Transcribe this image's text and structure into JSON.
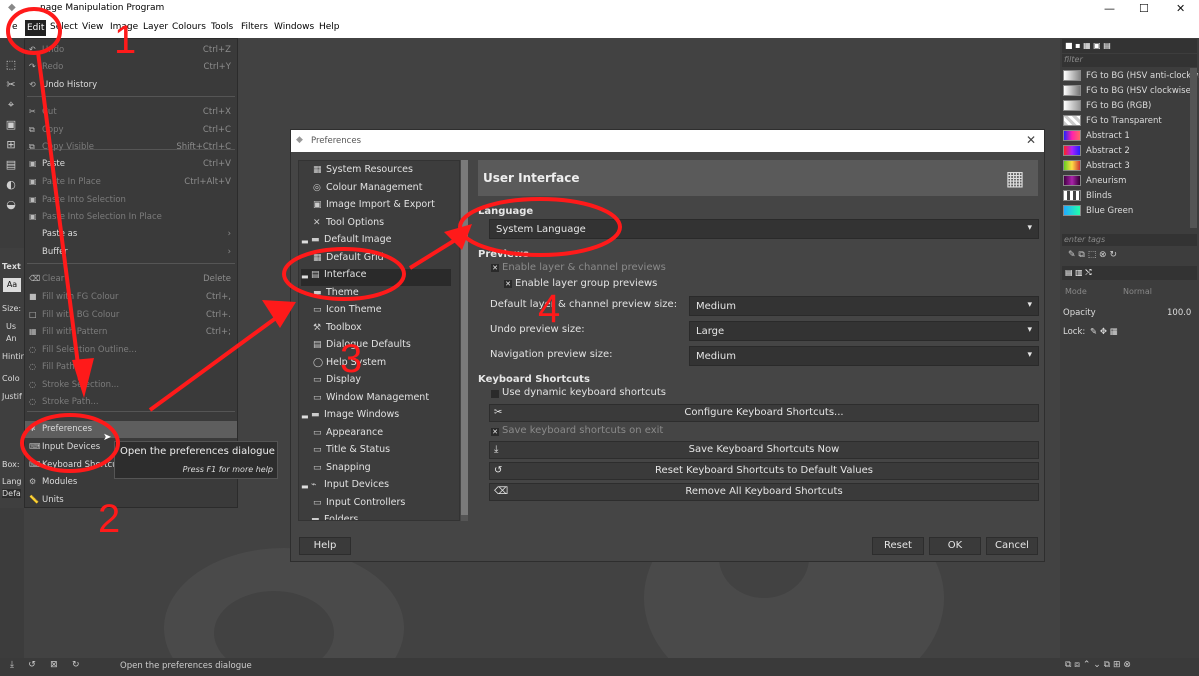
{
  "window": {
    "title": "GNU Image Manipulation Program",
    "title_visible": "nage Manipulation Program"
  },
  "menubar": [
    "e",
    "Edit",
    "Select",
    "View",
    "Image",
    "Layer",
    "Colours",
    "Tools",
    "Filters",
    "Windows",
    "Help"
  ],
  "edit_menu": {
    "items": [
      {
        "label": "Undo",
        "accel": "Ctrl+Z",
        "disabled": true
      },
      {
        "label": "Redo",
        "accel": "Ctrl+Y",
        "disabled": true
      },
      {
        "label": "Undo History",
        "accel": "",
        "disabled": false
      },
      {
        "label": "Cut",
        "accel": "Ctrl+X",
        "disabled": true
      },
      {
        "label": "Copy",
        "accel": "Ctrl+C",
        "disabled": true
      },
      {
        "label": "Copy Visible",
        "accel": "Shift+Ctrl+C",
        "disabled": true
      },
      {
        "label": "Paste",
        "accel": "Ctrl+V",
        "disabled": false
      },
      {
        "label": "Paste In Place",
        "accel": "Ctrl+Alt+V",
        "disabled": true
      },
      {
        "label": "Paste Into Selection",
        "accel": "",
        "disabled": true
      },
      {
        "label": "Paste Into Selection In Place",
        "accel": "",
        "disabled": true
      },
      {
        "label": "Paste as",
        "accel": "›",
        "disabled": false
      },
      {
        "label": "Buffer",
        "accel": "›",
        "disabled": false
      },
      {
        "label": "Clear",
        "accel": "Delete",
        "disabled": true
      },
      {
        "label": "Fill with FG Colour",
        "accel": "Ctrl+,",
        "disabled": true
      },
      {
        "label": "Fill with BG Colour",
        "accel": "Ctrl+.",
        "disabled": true
      },
      {
        "label": "Fill with Pattern",
        "accel": "Ctrl+;",
        "disabled": true
      },
      {
        "label": "Fill Selection Outline...",
        "accel": "",
        "disabled": true
      },
      {
        "label": "Fill Path...",
        "accel": "",
        "disabled": true
      },
      {
        "label": "Stroke Selection...",
        "accel": "",
        "disabled": true
      },
      {
        "label": "Stroke Path...",
        "accel": "",
        "disabled": true
      },
      {
        "label": "Preferences",
        "accel": "",
        "disabled": false
      },
      {
        "label": "Input Devices",
        "accel": "",
        "disabled": false
      },
      {
        "label": "Keyboard Shortcuts",
        "accel": "",
        "disabled": false
      },
      {
        "label": "Modules",
        "accel": "",
        "disabled": false
      },
      {
        "label": "Units",
        "accel": "",
        "disabled": false
      }
    ]
  },
  "tooltip": {
    "text": "Open the preferences dialogue",
    "hint": "Press F1 for more help"
  },
  "preferences": {
    "title": "Preferences",
    "tree": [
      {
        "label": "System Resources",
        "level": 1
      },
      {
        "label": "Colour Management",
        "level": 1
      },
      {
        "label": "Image Import & Export",
        "level": 1
      },
      {
        "label": "Tool Options",
        "level": 1
      },
      {
        "label": "Default Image",
        "level": 0
      },
      {
        "label": "Default Grid",
        "level": 1
      },
      {
        "label": "Interface",
        "level": 0
      },
      {
        "label": "Theme",
        "level": 1
      },
      {
        "label": "Icon Theme",
        "level": 1
      },
      {
        "label": "Toolbox",
        "level": 1
      },
      {
        "label": "Dialogue Defaults",
        "level": 1
      },
      {
        "label": "Help System",
        "level": 1
      },
      {
        "label": "Display",
        "level": 1
      },
      {
        "label": "Window Management",
        "level": 1
      },
      {
        "label": "Image Windows",
        "level": 0
      },
      {
        "label": "Appearance",
        "level": 1
      },
      {
        "label": "Title & Status",
        "level": 1
      },
      {
        "label": "Snapping",
        "level": 1
      },
      {
        "label": "Input Devices",
        "level": 0
      },
      {
        "label": "Input Controllers",
        "level": 1
      },
      {
        "label": "Folders",
        "level": 0
      }
    ],
    "panel_title": "User Interface",
    "language": {
      "heading": "Language",
      "value": "System Language"
    },
    "previews": {
      "heading": "Previews",
      "enable_layer": "Enable layer & channel previews",
      "enable_group": "Enable layer group previews",
      "rows": [
        {
          "label": "Default layer & channel preview size:",
          "value": "Medium"
        },
        {
          "label": "Undo preview size:",
          "value": "Large"
        },
        {
          "label": "Navigation preview size:",
          "value": "Medium"
        }
      ]
    },
    "shortcuts": {
      "heading": "Keyboard Shortcuts",
      "dynamic": "Use dynamic keyboard shortcuts",
      "configure": "Configure Keyboard Shortcuts...",
      "save_on_exit": "Save keyboard shortcuts on exit",
      "save_now": "Save Keyboard Shortcuts Now",
      "reset": "Reset Keyboard Shortcuts to Default Values",
      "remove": "Remove All Keyboard Shortcuts"
    },
    "buttons": {
      "help": "Help",
      "reset": "Reset",
      "ok": "OK",
      "cancel": "Cancel"
    }
  },
  "dock": {
    "filter_placeholder": "filter",
    "gradients": [
      "FG to BG (HSV anti-clockwise)",
      "FG to BG (HSV clockwise)",
      "FG to BG (RGB)",
      "FG to Transparent",
      "Abstract 1",
      "Abstract 2",
      "Abstract 3",
      "Aneurism",
      "Blinds",
      "Blue Green"
    ],
    "tag_placeholder": "enter tags",
    "mode_label": "Mode",
    "mode_value": "Normal",
    "opacity_label": "Opacity",
    "opacity_value": "100.0",
    "lock_label": "Lock:"
  },
  "tool_options_fragments": [
    "Text",
    "Aa",
    "Size:",
    "Us",
    "An",
    "Hintin",
    "Colo",
    "Justif",
    "Box:",
    "Lang",
    "Defa"
  ],
  "status": {
    "text": "Open the preferences dialogue"
  },
  "annotations": [
    "1",
    "2",
    "3",
    "4"
  ],
  "colors": {
    "annotation": "#ff1a1a",
    "dialog_bg": "#454545"
  }
}
